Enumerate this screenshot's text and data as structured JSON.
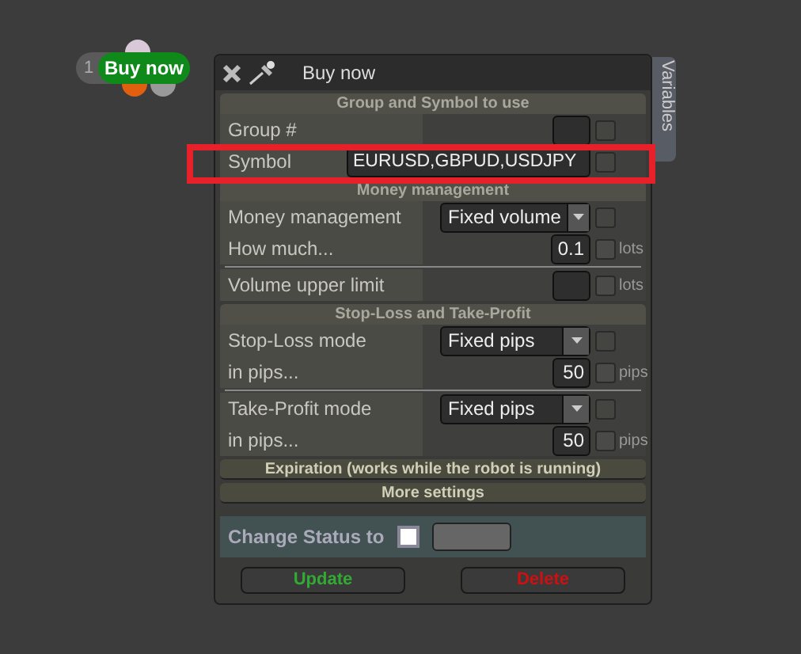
{
  "node": {
    "number": "1",
    "label": "Buy now"
  },
  "window": {
    "title": "Buy now",
    "side_tab": "Variables"
  },
  "sections": [
    {
      "title": "Group and Symbol to use",
      "expanded": true,
      "rows": [
        {
          "kind": "input",
          "label": "Group #",
          "divider_before": false,
          "highlight": false,
          "checked": false
        },
        {
          "kind": "wide_input",
          "label": "Symbol",
          "value": "EURUSD,GBPUD,USDJPY",
          "divider_before": false,
          "highlight": true,
          "checked": false
        }
      ]
    },
    {
      "title": "Money management",
      "expanded": true,
      "rows": [
        {
          "kind": "select",
          "label": "Money management",
          "value": "Fixed volume",
          "divider_before": false,
          "highlight": false,
          "checked": false
        },
        {
          "kind": "input",
          "label": "How much...",
          "value": "0.1",
          "unit": "lots",
          "divider_before": false,
          "highlight": false,
          "checked": false
        },
        {
          "kind": "input",
          "label": "Volume upper limit",
          "unit": "lots",
          "divider_before": true,
          "highlight": false,
          "checked": false
        }
      ]
    },
    {
      "title": "Stop-Loss and Take-Profit",
      "expanded": true,
      "rows": [
        {
          "kind": "select",
          "label": "Stop-Loss mode",
          "value": "Fixed pips",
          "divider_before": false,
          "highlight": false,
          "checked": false
        },
        {
          "kind": "input",
          "label": "in pips...",
          "value": "50",
          "unit": "pips",
          "divider_before": false,
          "highlight": false,
          "checked": false
        },
        {
          "kind": "select",
          "label": "Take-Profit mode",
          "value": "Fixed pips",
          "divider_before": true,
          "highlight": false,
          "checked": false
        },
        {
          "kind": "input",
          "label": "in pips...",
          "value": "50",
          "unit": "pips",
          "divider_before": false,
          "highlight": false,
          "checked": false
        }
      ]
    },
    {
      "title": "Expiration (works while the robot is running)",
      "expanded": false
    },
    {
      "title": "More settings",
      "expanded": false
    }
  ],
  "status": {
    "label": "Change Status to",
    "checked": false
  },
  "buttons": [
    {
      "label": "Update",
      "kind": "update"
    },
    {
      "label": "Delete",
      "kind": "delete"
    }
  ]
}
